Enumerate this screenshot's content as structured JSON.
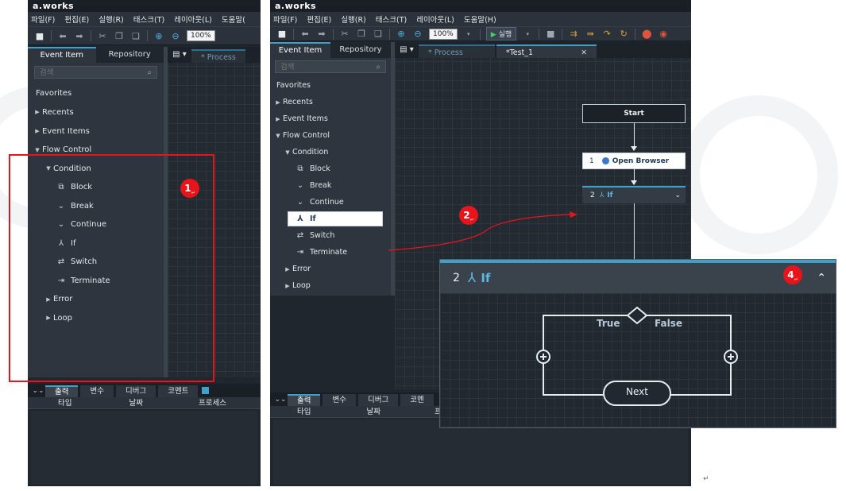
{
  "app": {
    "title": "a.works",
    "menu": [
      "파일(F)",
      "편집(E)",
      "실행(R)",
      "태스크(T)",
      "레이아웃(L)",
      "도움말(H)"
    ],
    "menu_left_truncated_last": "도움말(",
    "zoom": "100%",
    "run_label": "실행"
  },
  "sidebar": {
    "tabs": [
      "Event Item",
      "Repository"
    ],
    "search_placeholder": "검색",
    "items": {
      "favorites": "Favorites",
      "recents": "Recents",
      "event_items": "Event Items",
      "flow_control": "Flow Control",
      "condition": "Condition",
      "block": "Block",
      "break": "Break",
      "continue": "Continue",
      "if": "If",
      "switch": "Switch",
      "terminate": "Terminate",
      "error": "Error",
      "loop": "Loop"
    }
  },
  "doc_tabs": {
    "process": "* Process",
    "test": "*Test_1",
    "close": "✕"
  },
  "bottom_panel": {
    "tabs": [
      "출력",
      "변수",
      "디버그",
      "코멘트"
    ],
    "tab_truncated": "코멘",
    "columns": [
      "타입",
      "날짜",
      "프로세스"
    ],
    "column_truncated": "프"
  },
  "flow": {
    "start": "Start",
    "step1_num": "1",
    "step1_label": "Open Browser",
    "step2_num": "2",
    "step2_label": "If"
  },
  "callout": {
    "num": "2",
    "label": "If",
    "true_label": "True",
    "false_label": "False",
    "next_label": "Next"
  },
  "badges": {
    "b1": "1",
    "b2": "2",
    "b4": "4",
    "mark": "↵"
  },
  "colors": {
    "accent": "#3fa0c9",
    "annotation_red": "#e8141c",
    "panel_dark": "#2e353e",
    "canvas_dark": "#242a31"
  }
}
